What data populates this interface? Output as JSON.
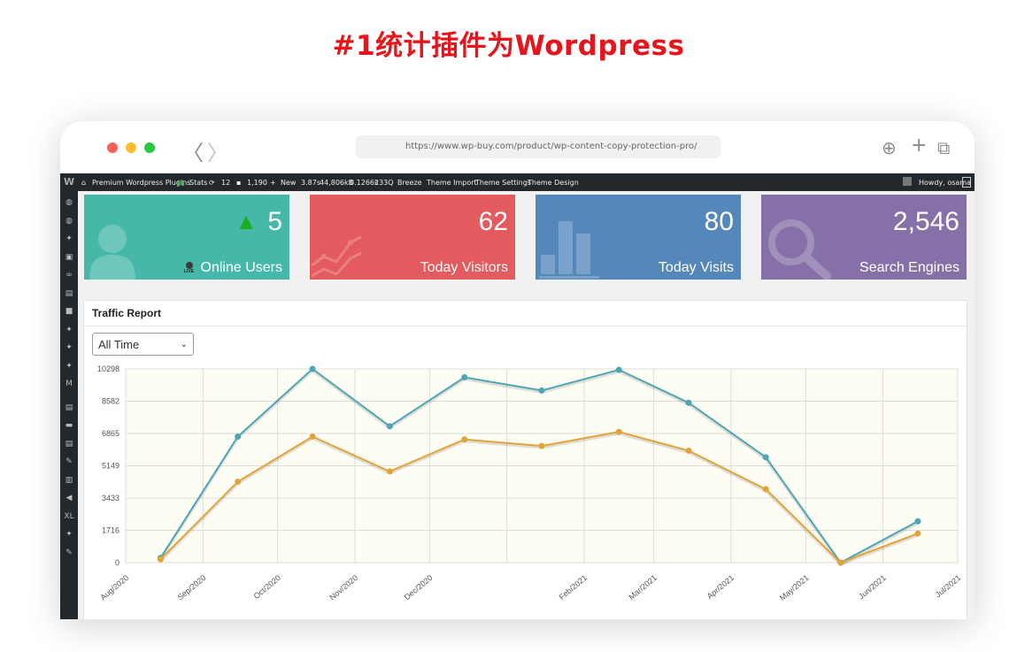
{
  "headline": "#1统计插件为Wordpress",
  "browser": {
    "url": "https://www.wp-buy.com/product/wp-content-copy-protection-pro/",
    "back_glyph": "〈",
    "forward_glyph": "〉",
    "download_glyph": "⊕",
    "plus_glyph": "+",
    "copy_glyph": "⧉"
  },
  "admin_bar": {
    "wp_glyph": "W",
    "items": [
      {
        "label": "Premium Wordpress Plugins",
        "icon": "home-icon"
      },
      {
        "label": "Stats",
        "icon": "bar-chart-icon"
      },
      {
        "label": "12",
        "icon": "updates-icon"
      },
      {
        "label": "1,190",
        "icon": "comments-icon"
      },
      {
        "label": "New",
        "icon": "plus-icon"
      },
      {
        "label": "3.87s",
        "icon": ""
      },
      {
        "label": "44,806kB",
        "icon": ""
      },
      {
        "label": "0.1266s",
        "icon": ""
      },
      {
        "label": "233Q",
        "icon": ""
      },
      {
        "label": "Breeze",
        "icon": ""
      },
      {
        "label": "Theme Import",
        "icon": ""
      },
      {
        "label": "Theme Settings",
        "icon": ""
      },
      {
        "label": "Theme Design",
        "icon": ""
      }
    ],
    "howdy": "Howdy, osama"
  },
  "side_menu": [
    "dashboard-icon",
    "jetpack-icon",
    "pin-icon",
    "media-icon",
    "links-icon",
    "pages-icon",
    "comments-icon",
    "pin-icon",
    "pin-icon",
    "pin-icon",
    "mailchimp-icon",
    "forms-icon",
    "slider-icon",
    "appearance-icon",
    "brush-icon",
    "stats-icon",
    "megaphone-icon",
    "xl-icon",
    "pin-icon",
    "tools-icon"
  ],
  "side_menu_glyphs": [
    "◍",
    "◍",
    "✦",
    "▣",
    "∞",
    "▤",
    "■",
    "✦",
    "✦",
    "✦",
    "M",
    "▤",
    "▬",
    "▤",
    "✎",
    "▥",
    "◀",
    "XL",
    "✦",
    "✎"
  ],
  "cards": [
    {
      "value": "5",
      "label": "Online Users",
      "color": "#46b8aa",
      "trend": "▲",
      "trend_color": "#1aaf23",
      "live": "LIVE"
    },
    {
      "value": "62",
      "label": "Today Visitors",
      "color": "#e45b5f"
    },
    {
      "value": "80",
      "label": "Today Visits",
      "color": "#5487ba"
    },
    {
      "value": "2,546",
      "label": "Search Engines",
      "color": "#8571a7"
    }
  ],
  "traffic": {
    "title": "Traffic Report",
    "select_value": "All Time",
    "select_chevron": "⌄"
  },
  "chart_data": {
    "type": "line",
    "title": "",
    "x_ticks": [
      "Aug/2020",
      "Sep/2020",
      "Oct/2020",
      "Nov/2020",
      "Dec/2020",
      "Feb/2021",
      "Mar/2021",
      "Apr/2021",
      "May/2021",
      "Jun/2021",
      "Jul/2021"
    ],
    "y_ticks": [
      0,
      1716,
      3433,
      5149,
      6865,
      8582,
      10298
    ],
    "ylim": [
      0,
      10298
    ],
    "grid": true,
    "background": "#fefdf3",
    "series": [
      {
        "color": "#4ea5b6",
        "points": [
          [
            "2020-08-15",
            250
          ],
          [
            "2020-09-15",
            6700
          ],
          [
            "2020-10-15",
            10298
          ],
          [
            "2020-11-15",
            7250
          ],
          [
            "2020-12-15",
            9850
          ],
          [
            "2021-01-15",
            9150
          ],
          [
            "2021-02-15",
            10250
          ],
          [
            "2021-03-15",
            8500
          ],
          [
            "2021-04-15",
            5600
          ],
          [
            "2021-05-15",
            0
          ],
          [
            "2021-06-15",
            2200
          ]
        ]
      },
      {
        "color": "#e3a33b",
        "points": [
          [
            "2020-08-15",
            180
          ],
          [
            "2020-09-15",
            4300
          ],
          [
            "2020-10-15",
            6700
          ],
          [
            "2020-11-15",
            4850
          ],
          [
            "2020-12-15",
            6550
          ],
          [
            "2021-01-15",
            6200
          ],
          [
            "2021-02-15",
            6950
          ],
          [
            "2021-03-15",
            5950
          ],
          [
            "2021-04-15",
            3900
          ],
          [
            "2021-05-15",
            0
          ],
          [
            "2021-06-15",
            1550
          ]
        ]
      }
    ]
  }
}
